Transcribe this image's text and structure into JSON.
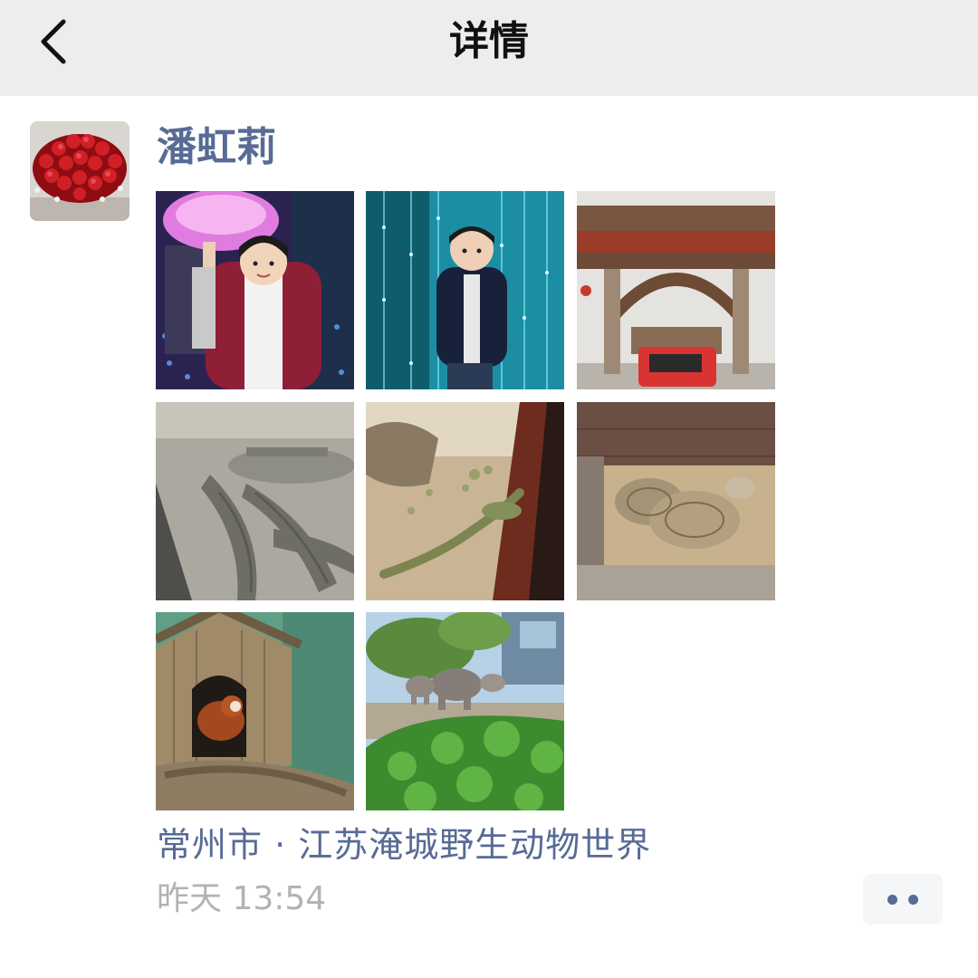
{
  "navbar": {
    "title": "详情",
    "back_icon": "chevron-left-icon"
  },
  "post": {
    "author": "潘虹莉",
    "avatar": "red-roses-bouquet-image",
    "photos": [
      {
        "name": "child-holding-pink-jellyfish-lantern-photo"
      },
      {
        "name": "child-in-blue-light-curtain-photo"
      },
      {
        "name": "zoo-entrance-gate-photo"
      },
      {
        "name": "crocodiles-enclosure-photo"
      },
      {
        "name": "iguana-enclosure-photo"
      },
      {
        "name": "tortoises-enclosure-photo"
      },
      {
        "name": "red-panda-hut-photo"
      },
      {
        "name": "elephants-enclosure-photo"
      }
    ],
    "location": "常州市 · 江苏淹城野生动物世界",
    "time": "昨天 13:54",
    "more_icon": "two-dots-more-icon"
  },
  "colors": {
    "navbar_bg": "#ededed",
    "link_blue": "#576b95",
    "timestamp_gray": "#b2b2b2",
    "more_button_bg": "#f5f6f7"
  }
}
